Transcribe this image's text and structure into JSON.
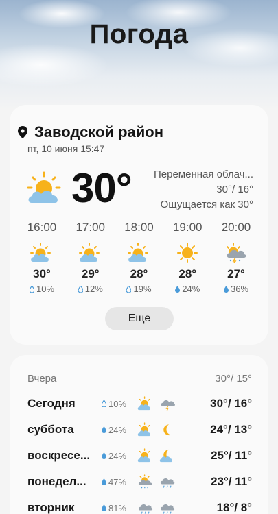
{
  "app": {
    "title": "Погода"
  },
  "current": {
    "location": "Заводской район",
    "datetime": "пт, 10 июня 15:47",
    "temperature": "30°",
    "condition": "Переменная облач...",
    "hi_lo": "30°/ 16°",
    "feels_like": "Ощущается как 30°",
    "icon": "partly-cloudy-icon"
  },
  "hourly": [
    {
      "time": "16:00",
      "icon": "partly-cloudy-icon",
      "temp": "30°",
      "precip": "10%"
    },
    {
      "time": "17:00",
      "icon": "partly-cloudy-icon",
      "temp": "29°",
      "precip": "12%"
    },
    {
      "time": "18:00",
      "icon": "partly-cloudy-icon",
      "temp": "28°",
      "precip": "19%"
    },
    {
      "time": "19:00",
      "icon": "sun-icon",
      "temp": "28°",
      "precip": "24%"
    },
    {
      "time": "20:00",
      "icon": "thunderstorm-icon",
      "temp": "27°",
      "precip": "36%"
    }
  ],
  "more_button": "Еще",
  "yesterday": {
    "label": "Вчера",
    "temps": "30°/ 15°"
  },
  "daily": [
    {
      "day": "Сегодня",
      "precip": "10%",
      "icon_day": "partly-cloudy-icon",
      "icon_night": "thunderstorm-icon",
      "temps": "30°/ 16°"
    },
    {
      "day": "суббота",
      "precip": "24%",
      "icon_day": "partly-cloudy-icon",
      "icon_night": "moon-icon",
      "temps": "24°/ 13°"
    },
    {
      "day": "воскресе...",
      "precip": "24%",
      "icon_day": "partly-cloudy-icon",
      "icon_night": "moon-cloud-icon",
      "temps": "25°/ 11°"
    },
    {
      "day": "понедел...",
      "precip": "47%",
      "icon_day": "sun-rain-icon",
      "icon_night": "rain-icon",
      "temps": "23°/ 11°"
    },
    {
      "day": "вторник",
      "precip": "81%",
      "icon_day": "rain-icon",
      "icon_night": "rain-icon",
      "temps": "18°/ 8°"
    }
  ],
  "colors": {
    "sun": "#f7b21b",
    "cloud": "#8ec3e8",
    "drop": "#4a9bd9",
    "card": "#fafafa"
  }
}
